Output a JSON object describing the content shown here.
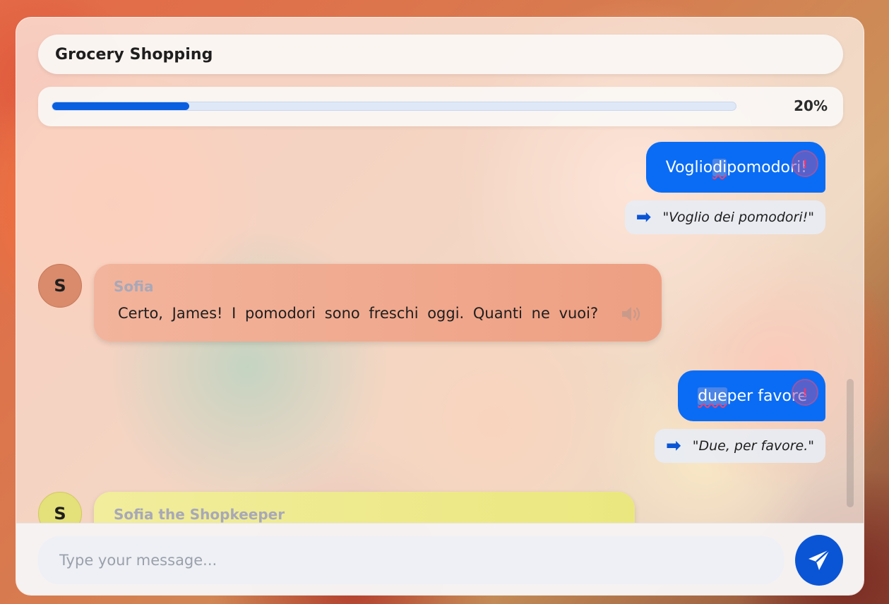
{
  "header": {
    "title": "Grocery Shopping"
  },
  "progress": {
    "value": 0.2,
    "label": "20%"
  },
  "messages": [
    {
      "role": "user",
      "before": "Voglio ",
      "error_word": "di",
      "after": " pomodori!",
      "correction": "\"Voglio dei pomodori!\""
    },
    {
      "role": "bot",
      "avatar": "S",
      "name": "Sofia",
      "text": "Certo, James! I pomodori sono freschi oggi. Quanti ne vuoi?"
    },
    {
      "role": "user",
      "before": "",
      "error_word": "due",
      "after": " per favore",
      "correction": "\"Due, per favore.\""
    },
    {
      "role": "bot",
      "avatar": "S",
      "name": "Sofia the Shopkeeper"
    }
  ],
  "composer": {
    "placeholder": "Type your message..."
  },
  "icons": {
    "correction_arrow": "right-arrow-icon",
    "speaker": "speaker-icon",
    "send": "send-icon",
    "alert": "alert-icon"
  },
  "colors": {
    "accent": "#0a6cf5",
    "send": "#0a55d6",
    "sofia_bubble": "#f0a98e",
    "shopkeeper_bubble": "#ede98a",
    "error_underline": "#e0457a"
  }
}
